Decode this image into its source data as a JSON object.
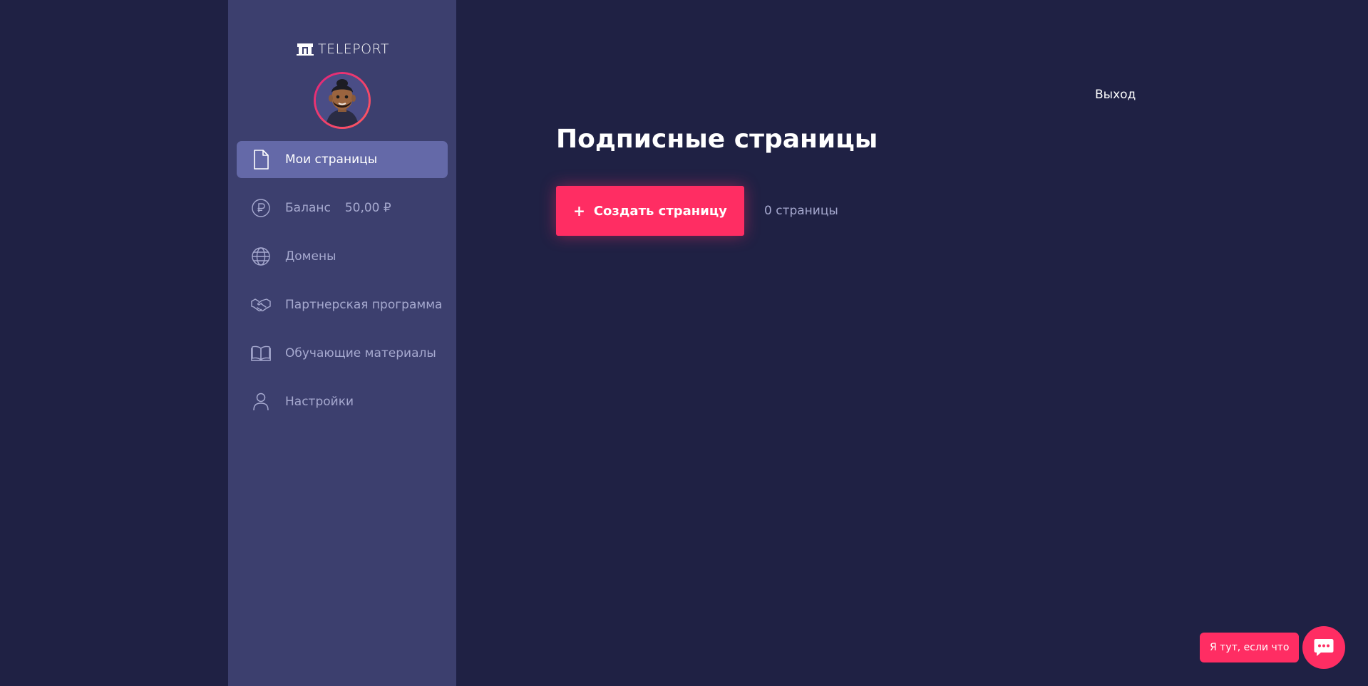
{
  "app": {
    "logo_text": "TELEPORT"
  },
  "sidebar": {
    "items": [
      {
        "label": "Мои страницы",
        "icon": "document-icon",
        "active": true
      },
      {
        "label": "Баланс",
        "value": "50,00 ₽",
        "icon": "ruble-icon",
        "active": false
      },
      {
        "label": "Домены",
        "icon": "globe-icon",
        "active": false
      },
      {
        "label": "Партнерская программа",
        "icon": "handshake-icon",
        "active": false
      },
      {
        "label": "Обучающие материалы",
        "icon": "book-icon",
        "active": false
      },
      {
        "label": "Настройки",
        "icon": "user-icon",
        "active": false
      }
    ]
  },
  "header": {
    "logout_label": "Выход"
  },
  "main": {
    "title": "Подписные страницы",
    "create_button_label": "Создать страницу",
    "create_button_icon": "plus-icon",
    "pages_count": "0 страницы"
  },
  "chat": {
    "bubble_text": "Я тут, если что",
    "icon": "chat-icon"
  },
  "colors": {
    "background": "#1f2144",
    "sidebar": "#3c3f6e",
    "active_item": "#6469a8",
    "accent": "#ff2d63",
    "muted_text": "#a6a9cf"
  }
}
